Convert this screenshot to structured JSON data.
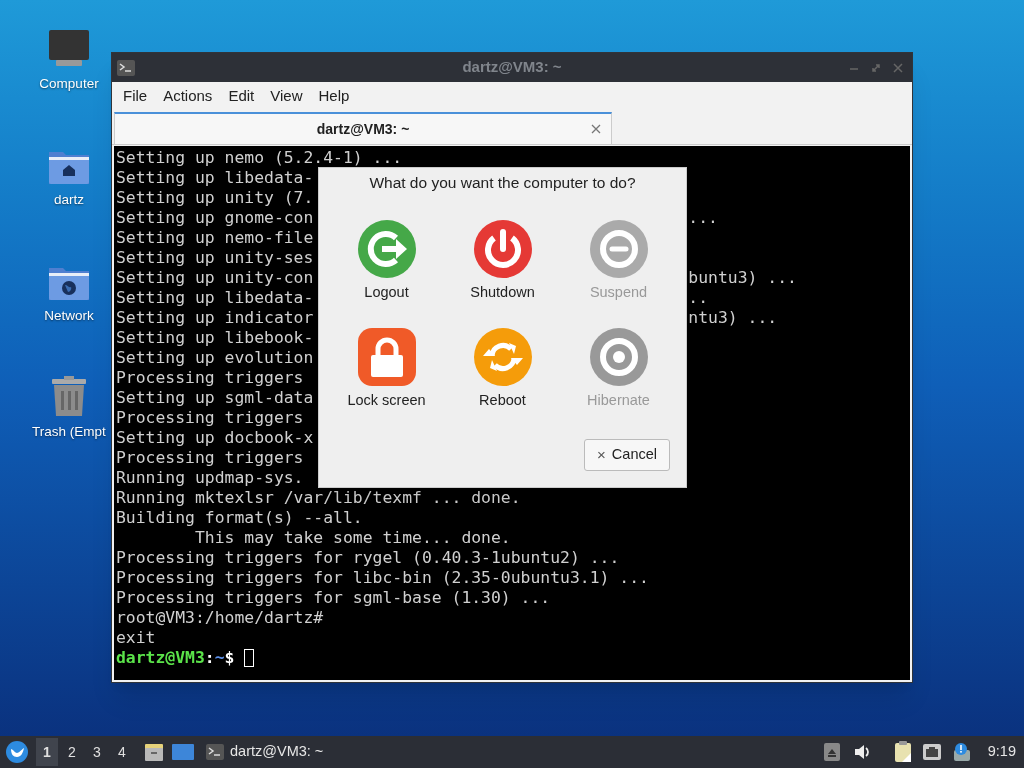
{
  "desktop_icons": [
    {
      "label": "Computer",
      "kind": "computer"
    },
    {
      "label": "dartz",
      "kind": "home"
    },
    {
      "label": "Network",
      "kind": "network"
    },
    {
      "label": "Trash (Empt",
      "kind": "trash"
    }
  ],
  "window": {
    "title": "dartz@VM3: ~",
    "menu": [
      "File",
      "Actions",
      "Edit",
      "View",
      "Help"
    ],
    "tabs": [
      {
        "label": "dartz@VM3: ~",
        "selected": true
      }
    ],
    "terminal": {
      "lines": [
        {
          "left": "Setting up nemo (5.2.4-1) ..."
        },
        {
          "left": "Setting up libedata-"
        },
        {
          "left": "Setting up unity (7."
        },
        {
          "left": "Setting up gnome-con",
          "right": "..."
        },
        {
          "left": "Setting up nemo-file"
        },
        {
          "left": "Setting up unity-ses"
        },
        {
          "left": "Setting up unity-con",
          "right": "buntu3) ..."
        },
        {
          "left": "Setting up libedata-",
          "right": ".."
        },
        {
          "left": "Setting up indicator",
          "right": "ntu3) ..."
        },
        {
          "left": "Setting up libebook-"
        },
        {
          "left": "Setting up evolution"
        },
        {
          "left": "Processing triggers"
        },
        {
          "left": "Setting up sgml-data"
        },
        {
          "left": "Processing triggers"
        },
        {
          "left": "Setting up docbook-x"
        },
        {
          "left": "Processing triggers"
        },
        {
          "left": "Running updmap-sys."
        },
        {
          "left": "Running mktexlsr /var/lib/texmf ... done."
        },
        {
          "left": "Building format(s) --all."
        },
        {
          "left": "        This may take some time... done."
        },
        {
          "left": "Processing triggers for rygel (0.40.3-1ubuntu2) ..."
        },
        {
          "left": "Processing triggers for libc-bin (2.35-0ubuntu3.1) ..."
        },
        {
          "left": "Processing triggers for sgml-base (1.30) ..."
        },
        {
          "left": "root@VM3:/home/dartz#"
        },
        {
          "left": "exit"
        }
      ],
      "prompt": {
        "user_host": "dartz@VM3",
        "separator": ":",
        "path": "~",
        "symbol": "$"
      }
    }
  },
  "dialog": {
    "question": "What do you want the computer to do?",
    "actions": [
      {
        "label": "Logout",
        "kind": "logout",
        "disabled": false
      },
      {
        "label": "Shutdown",
        "kind": "shutdown",
        "disabled": false
      },
      {
        "label": "Suspend",
        "kind": "suspend",
        "disabled": true
      },
      {
        "label": "Lock screen",
        "kind": "lock",
        "disabled": false
      },
      {
        "label": "Reboot",
        "kind": "reboot",
        "disabled": false
      },
      {
        "label": "Hibernate",
        "kind": "hibernate",
        "disabled": true
      }
    ],
    "cancel": {
      "icon": "×",
      "label": "Cancel"
    }
  },
  "taskbar": {
    "workspaces": [
      {
        "label": "1",
        "selected": true
      },
      {
        "label": "2",
        "selected": false
      },
      {
        "label": "3",
        "selected": false
      },
      {
        "label": "4",
        "selected": false
      }
    ],
    "task": "dartz@VM3: ~",
    "clock": "9:19"
  }
}
